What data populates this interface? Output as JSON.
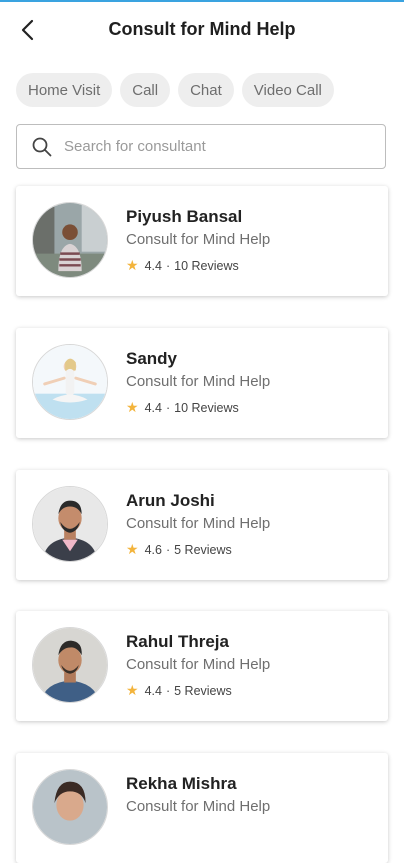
{
  "header": {
    "title": "Consult for Mind Help",
    "back_icon": "back-arrow-icon"
  },
  "filters": [
    "Home Visit",
    "Call",
    "Chat",
    "Video Call"
  ],
  "search": {
    "placeholder": "Search for consultant",
    "value": ""
  },
  "consultants": [
    {
      "name": "Piyush Bansal",
      "specialty": "Consult for Mind Help",
      "rating": "4.4",
      "reviews": "10 Reviews"
    },
    {
      "name": "Sandy",
      "specialty": "Consult for Mind Help",
      "rating": "4.4",
      "reviews": "10 Reviews"
    },
    {
      "name": "Arun Joshi",
      "specialty": "Consult for Mind Help",
      "rating": "4.6",
      "reviews": "5 Reviews"
    },
    {
      "name": "Rahul Threja",
      "specialty": "Consult for Mind Help",
      "rating": "4.4",
      "reviews": "5 Reviews"
    },
    {
      "name": "Rekha Mishra",
      "specialty": "Consult for Mind Help",
      "rating": "",
      "reviews": ""
    }
  ],
  "colors": {
    "accent_line": "#3aa3e0",
    "chip_bg": "#eeeeee",
    "star": "#f3b43c"
  }
}
